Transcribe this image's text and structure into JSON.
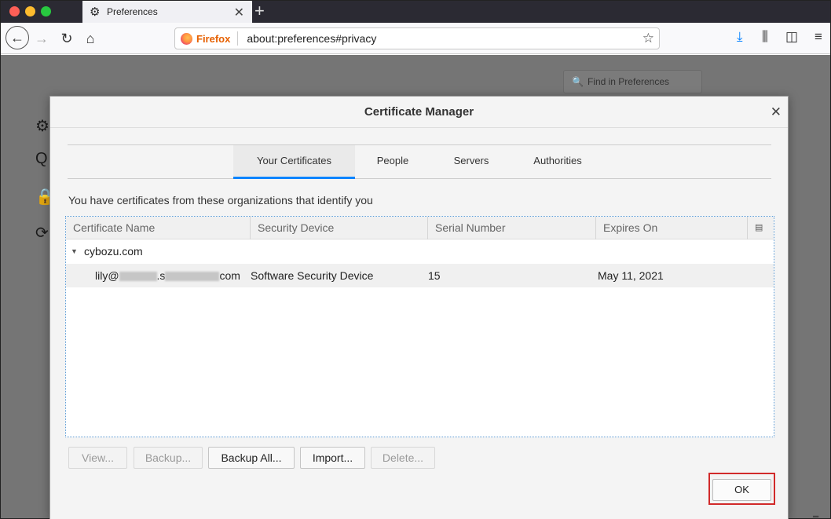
{
  "browser": {
    "tab_title": "Preferences",
    "new_tab_symbol": "+",
    "url_identity": "Firefox",
    "url": "about:preferences#privacy"
  },
  "preferences": {
    "search_placeholder": "Find in Preferences"
  },
  "dialog": {
    "title": "Certificate Manager",
    "tabs": [
      {
        "label": "Your Certificates",
        "selected": true
      },
      {
        "label": "People",
        "selected": false
      },
      {
        "label": "Servers",
        "selected": false
      },
      {
        "label": "Authorities",
        "selected": false
      }
    ],
    "description": "You have certificates from these organizations that identify you",
    "columns": [
      "Certificate Name",
      "Security Device",
      "Serial Number",
      "Expires On"
    ],
    "groups": [
      {
        "name": "cybozu.com",
        "expanded": true,
        "certificates": [
          {
            "name_prefix": "lily@",
            "name_mid": ".s",
            "name_suffix": "com",
            "security_device": "Software Security Device",
            "serial_number": "15",
            "expires_on": "May 11, 2021"
          }
        ]
      }
    ],
    "buttons": {
      "view": "View...",
      "backup": "Backup...",
      "backup_all": "Backup All...",
      "import": "Import...",
      "delete": "Delete...",
      "ok": "OK"
    }
  },
  "colors": {
    "accent": "#0a84ff",
    "highlight_box": "#d12a2a",
    "firefox_label": "#e66000"
  }
}
